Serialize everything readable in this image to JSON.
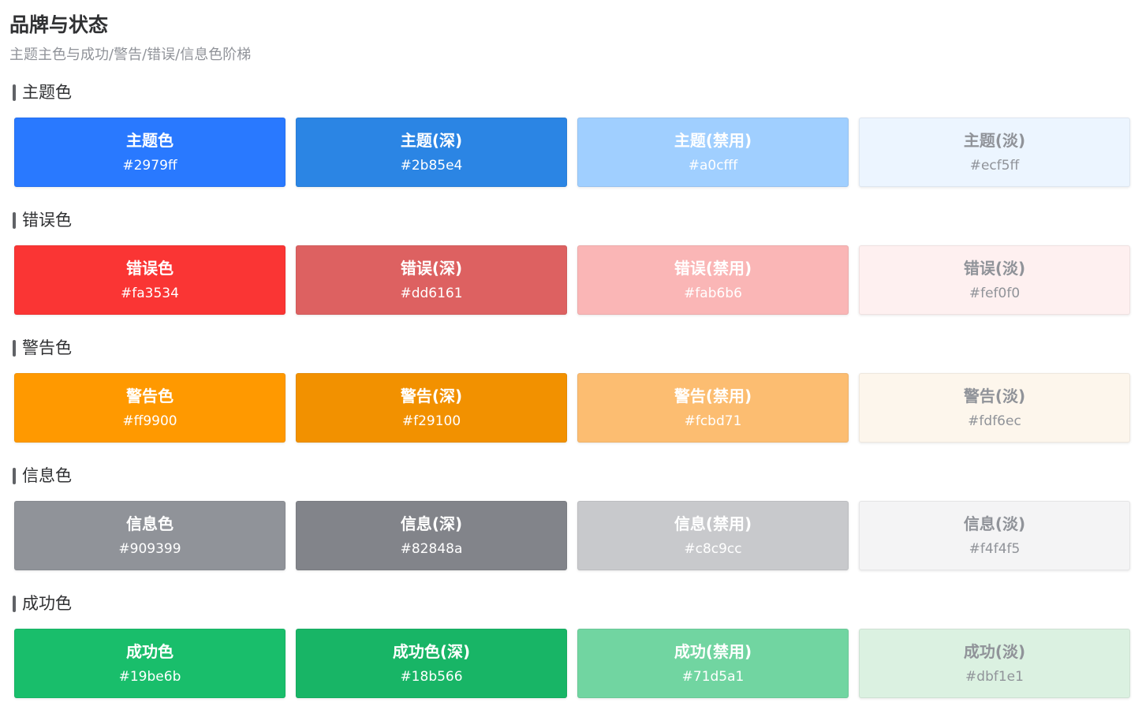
{
  "page": {
    "title": "品牌与状态",
    "subtitle": "主题主色与成功/警告/错误/信息色阶梯"
  },
  "sections": [
    {
      "label": "主题色",
      "swatches": [
        {
          "name": "主题色",
          "hex": "#2979ff",
          "bg": "#2979ff",
          "text_color": "#ffffff"
        },
        {
          "name": "主题(深)",
          "hex": "#2b85e4",
          "bg": "#2b85e4",
          "text_color": "#ffffff"
        },
        {
          "name": "主题(禁用)",
          "hex": "#a0cfff",
          "bg": "#a0cfff",
          "text_color": "#ffffff"
        },
        {
          "name": "主题(淡)",
          "hex": "#ecf5ff",
          "bg": "#ecf5ff",
          "text_color": "#909399"
        }
      ]
    },
    {
      "label": "错误色",
      "swatches": [
        {
          "name": "错误色",
          "hex": "#fa3534",
          "bg": "#fa3534",
          "text_color": "#ffffff"
        },
        {
          "name": "错误(深)",
          "hex": "#dd6161",
          "bg": "#dd6161",
          "text_color": "#ffffff"
        },
        {
          "name": "错误(禁用)",
          "hex": "#fab6b6",
          "bg": "#fab6b6",
          "text_color": "#ffffff"
        },
        {
          "name": "错误(淡)",
          "hex": "#fef0f0",
          "bg": "#fef0f0",
          "text_color": "#909399"
        }
      ]
    },
    {
      "label": "警告色",
      "swatches": [
        {
          "name": "警告色",
          "hex": "#ff9900",
          "bg": "#ff9900",
          "text_color": "#ffffff"
        },
        {
          "name": "警告(深)",
          "hex": "#f29100",
          "bg": "#f29100",
          "text_color": "#ffffff"
        },
        {
          "name": "警告(禁用)",
          "hex": "#fcbd71",
          "bg": "#fcbd71",
          "text_color": "#ffffff"
        },
        {
          "name": "警告(淡)",
          "hex": "#fdf6ec",
          "bg": "#fdf6ec",
          "text_color": "#909399"
        }
      ]
    },
    {
      "label": "信息色",
      "swatches": [
        {
          "name": "信息色",
          "hex": "#909399",
          "bg": "#909399",
          "text_color": "#ffffff"
        },
        {
          "name": "信息(深)",
          "hex": "#82848a",
          "bg": "#82848a",
          "text_color": "#ffffff"
        },
        {
          "name": "信息(禁用)",
          "hex": "#c8c9cc",
          "bg": "#c8c9cc",
          "text_color": "#ffffff"
        },
        {
          "name": "信息(淡)",
          "hex": "#f4f4f5",
          "bg": "#f4f4f5",
          "text_color": "#909399"
        }
      ]
    },
    {
      "label": "成功色",
      "swatches": [
        {
          "name": "成功色",
          "hex": "#19be6b",
          "bg": "#19be6b",
          "text_color": "#ffffff"
        },
        {
          "name": "成功色(深)",
          "hex": "#18b566",
          "bg": "#18b566",
          "text_color": "#ffffff"
        },
        {
          "name": "成功(禁用)",
          "hex": "#71d5a1",
          "bg": "#71d5a1",
          "text_color": "#ffffff"
        },
        {
          "name": "成功(淡)",
          "hex": "#dbf1e1",
          "bg": "#dbf1e1",
          "text_color": "#909399"
        }
      ]
    }
  ]
}
